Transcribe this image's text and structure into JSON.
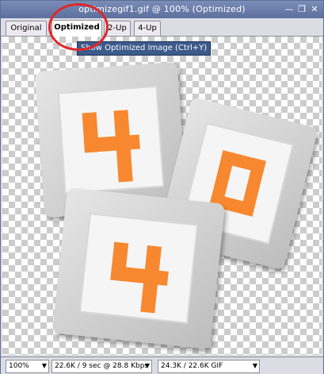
{
  "window": {
    "title": "optimizegif1.gif @ 100% (Optimized)",
    "min_label": "—",
    "restore_label": "❐",
    "close_label": "✕"
  },
  "tabs": [
    {
      "label": "Original"
    },
    {
      "label": "Optimized"
    },
    {
      "label": "2-Up"
    },
    {
      "label": "4-Up"
    }
  ],
  "tooltip": "Show Optimized Image  (Ctrl+Y)",
  "artwork": {
    "digits": [
      "4",
      "0",
      "4"
    ],
    "accent_color": "#f7882f",
    "frame_color": "#cfcfcf"
  },
  "status": {
    "zoom": "100%",
    "speed": "22.6K / 9 sec @ 28.8 Kbps",
    "size": "24.3K / 22.6K GIF"
  },
  "colors": {
    "titlebar": "#6a7eaa",
    "highlight_circle": "#e0262a"
  }
}
